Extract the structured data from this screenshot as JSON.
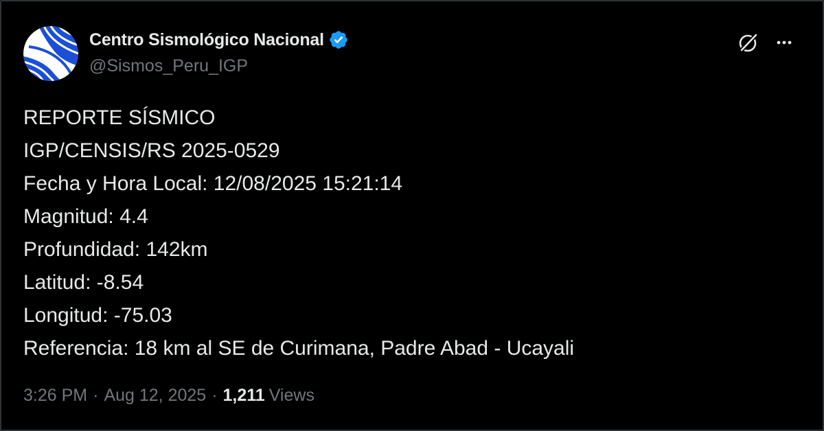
{
  "author": {
    "display_name": "Centro Sismológico Nacional",
    "handle": "@Sismos_Peru_IGP",
    "verified": true
  },
  "icons": {
    "avatar": "igp-logo-avatar",
    "verified": "verified-badge-icon",
    "grok": "grok-icon",
    "more": "more-options-icon"
  },
  "colors": {
    "background": "#000000",
    "text_primary": "#e7e9ea",
    "text_secondary": "#71767b",
    "verified_blue": "#1d9bf0",
    "avatar_blue": "#1a4fd6"
  },
  "tweet": {
    "lines": [
      "REPORTE SÍSMICO",
      "IGP/CENSIS/RS 2025-0529",
      "Fecha y Hora Local: 12/08/2025 15:21:14",
      "Magnitud: 4.4",
      "Profundidad: 142km",
      "Latitud: -8.54",
      "Longitud: -75.03",
      "Referencia: 18 km al SE de Curimana, Padre Abad - Ucayali"
    ]
  },
  "meta": {
    "time": "3:26 PM",
    "separator": "·",
    "date": "Aug 12, 2025",
    "views_count": "1,211",
    "views_label": "Views"
  }
}
